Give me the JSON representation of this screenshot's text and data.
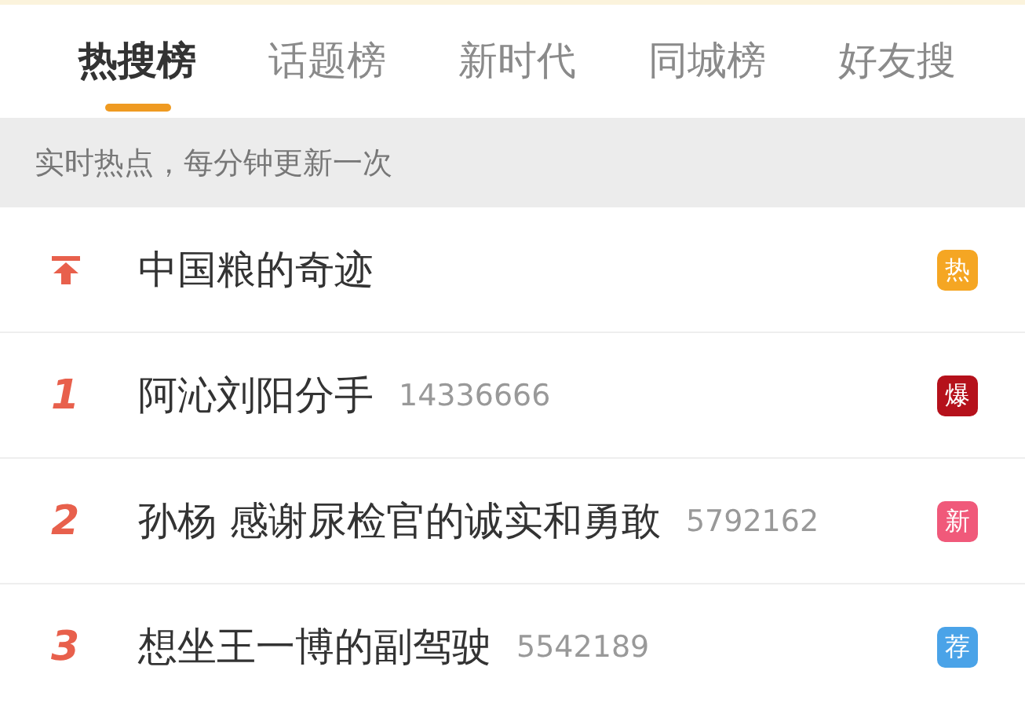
{
  "tabs": [
    {
      "label": "热搜榜",
      "selected": true
    },
    {
      "label": "话题榜",
      "selected": false
    },
    {
      "label": "新时代",
      "selected": false
    },
    {
      "label": "同城榜",
      "selected": false
    },
    {
      "label": "好友搜",
      "selected": false
    }
  ],
  "notice": "实时热点，每分钟更新一次",
  "items": [
    {
      "kind": "pinned",
      "title": "中国粮的奇迹",
      "badge": "热",
      "color": "#f5a623"
    },
    {
      "kind": "ranked",
      "rank": "1",
      "title": "阿沁刘阳分手",
      "count": "14336666",
      "badge": "爆",
      "color": "#b5111b"
    },
    {
      "kind": "ranked",
      "rank": "2",
      "title": "孙杨 感谢尿检官的诚实和勇敢",
      "count": "5792162",
      "badge": "新",
      "color": "#f0597a"
    },
    {
      "kind": "ranked",
      "rank": "3",
      "title": "想坐王一博的副驾驶",
      "count": "5542189",
      "badge": "荐",
      "color": "#4aa3e8"
    }
  ]
}
